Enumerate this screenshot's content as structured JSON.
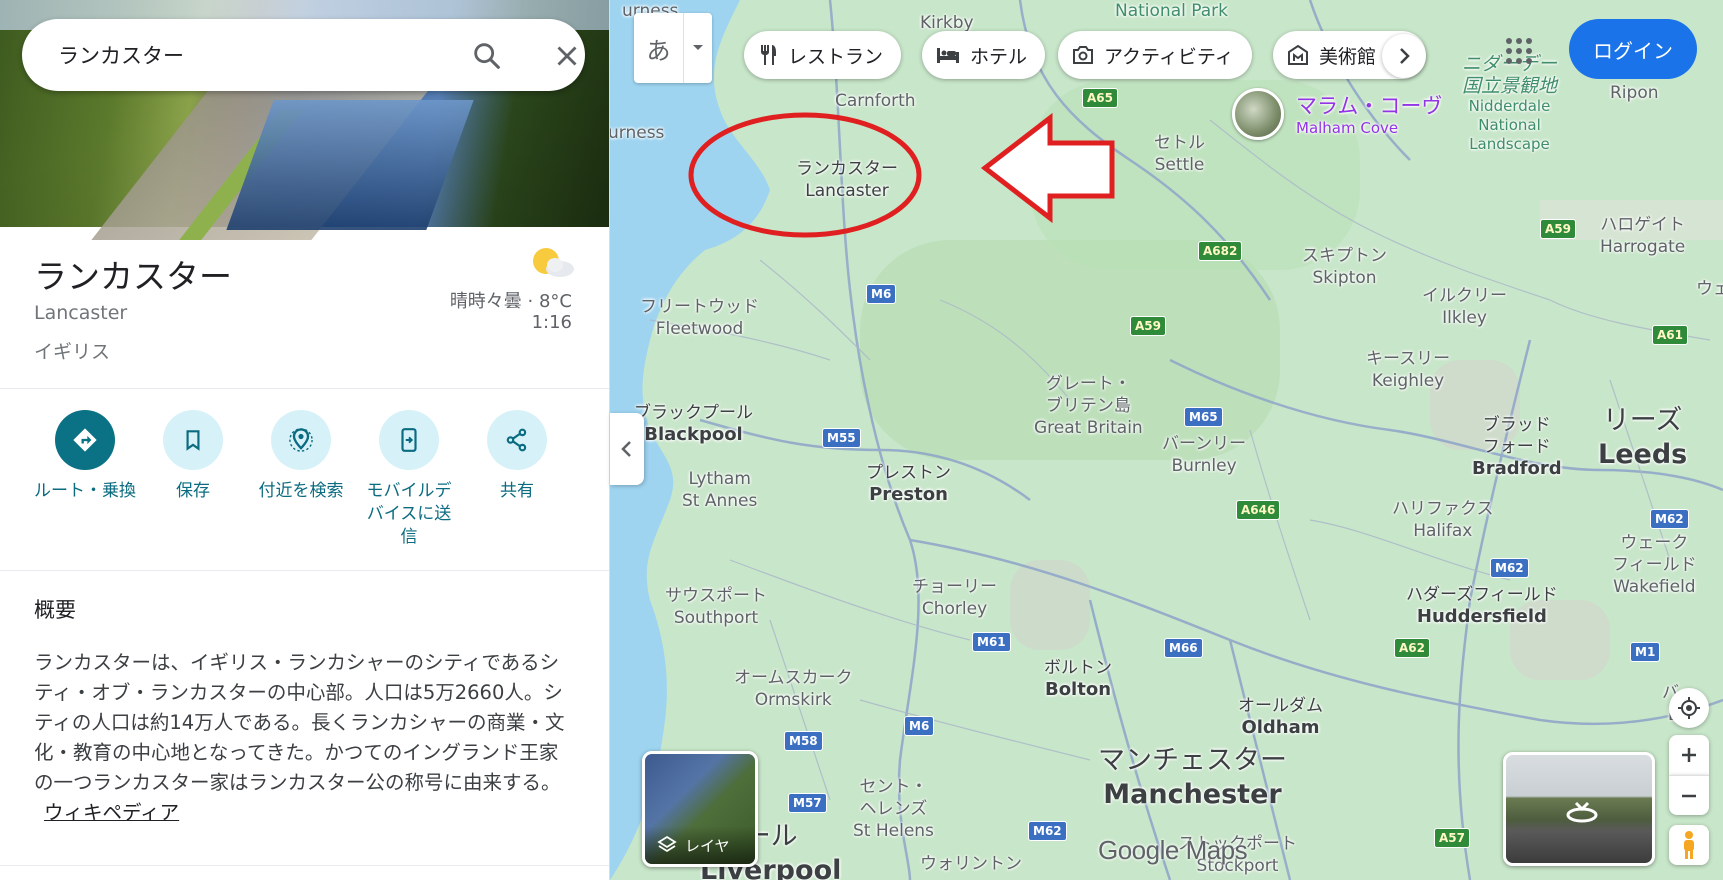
{
  "search": {
    "query": "ランカスター"
  },
  "place": {
    "title": "ランカスター",
    "subtitle": "Lancaster",
    "country": "イギリス",
    "weather": "晴時々曇 · 8°C",
    "time": "1:16"
  },
  "actions": [
    {
      "label": "ルート・乗換",
      "icon": "directions-icon"
    },
    {
      "label": "保存",
      "icon": "bookmark-icon"
    },
    {
      "label": "付近を検索",
      "icon": "nearby-icon"
    },
    {
      "label": "モバイルデバイスに送信",
      "icon": "send-to-phone-icon"
    },
    {
      "label": "共有",
      "icon": "share-icon"
    }
  ],
  "overview": {
    "title": "概要",
    "text": "ランカスターは、イギリス・ランカシャーのシティであるシティ・オブ・ランカスターの中心部。人口は5万2660人。シティの人口は約14万人である。長くランカシャーの商業・文化・教育の中心地となってきた。かつてのイングランド王家の一つランカスター家はランカスター公の称号に由来する。",
    "link": "ウィキペディア"
  },
  "ime": {
    "label": "あ"
  },
  "chips": [
    {
      "label": "レストラン",
      "icon": "restaurant-icon"
    },
    {
      "label": "ホテル",
      "icon": "hotel-icon"
    },
    {
      "label": "アクティビティ",
      "icon": "camera-icon"
    },
    {
      "label": "美術館",
      "icon": "museum-icon"
    }
  ],
  "header": {
    "login": "ログイン"
  },
  "map": {
    "places": [
      {
        "ja": "ランカスター",
        "en": "Lancaster"
      },
      {
        "ja": "フリートウッド",
        "en": "Fleetwood"
      },
      {
        "ja": "ブラックプール",
        "en": "Blackpool"
      },
      {
        "ja": "",
        "en": "Lytham\nSt Annes"
      },
      {
        "ja": "プレストン",
        "en": "Preston"
      },
      {
        "ja": "サウスポート",
        "en": "Southport"
      },
      {
        "ja": "オームスカーク",
        "en": "Ormskirk"
      },
      {
        "ja": "チョーリー",
        "en": "Chorley"
      },
      {
        "ja": "セント・\nヘレンズ",
        "en": "St Helens"
      },
      {
        "ja": "ボルトン",
        "en": "Bolton"
      },
      {
        "ja": "オールダム",
        "en": "Oldham"
      },
      {
        "ja": "マンチェスター",
        "en": "Manchester"
      },
      {
        "ja": "ストックポート",
        "en": "Stockport"
      },
      {
        "ja": "ウォリントン",
        "en": ""
      },
      {
        "ja": "バーンリー",
        "en": "Burnley"
      },
      {
        "ja": "グレート・\nブリテン島",
        "en": "Great Britain"
      },
      {
        "ja": "スキプトン",
        "en": "Skipton"
      },
      {
        "ja": "イルクリー",
        "en": "Ilkley"
      },
      {
        "ja": "キースリー",
        "en": "Keighley"
      },
      {
        "ja": "ブラッド\nフォード",
        "en": "Bradford"
      },
      {
        "ja": "リーズ",
        "en": "Leeds"
      },
      {
        "ja": "ハリファクス",
        "en": "Halifax"
      },
      {
        "ja": "ハダーズフィールド",
        "en": "Huddersfield"
      },
      {
        "ja": "ウェーク\nフィールド",
        "en": "Wakefield"
      },
      {
        "ja": "ハロゲイト",
        "en": "Harrogate"
      },
      {
        "ja": "",
        "en": "Ripon"
      },
      {
        "ja": "セトル",
        "en": "Settle"
      },
      {
        "ja": "",
        "en": "Carnforth"
      },
      {
        "ja": "",
        "en": "Kirkby"
      },
      {
        "ja": "",
        "en": "urness"
      },
      {
        "ja": "バー",
        "en": "Ba"
      },
      {
        "ja": "ール",
        "en": "Liverpool"
      },
      {
        "ja": "ウェ",
        "en": ""
      }
    ],
    "park_label": "National Park",
    "nidderdale": {
      "ja": "ニダーデー\n国立景観地",
      "en": "Nidderdale\nNational\nLandscape"
    },
    "poi": {
      "ja": "マラム・コーヴ",
      "en": "Malham Cove"
    },
    "roads": [
      "A65",
      "M6",
      "A682",
      "A59",
      "M65",
      "M55",
      "A646",
      "M61",
      "M66",
      "M6",
      "M58",
      "M57",
      "M62",
      "A59",
      "A61",
      "M62",
      "M62",
      "A62",
      "M1",
      "A57"
    ],
    "layers_label": "レイヤ",
    "logo": "Google Maps"
  },
  "colors": {
    "accent": "#0b7285",
    "login_bg": "#1a73e8",
    "annotation": "#e02020",
    "water": "#9ed4f0",
    "land": "#c8e6c9"
  }
}
